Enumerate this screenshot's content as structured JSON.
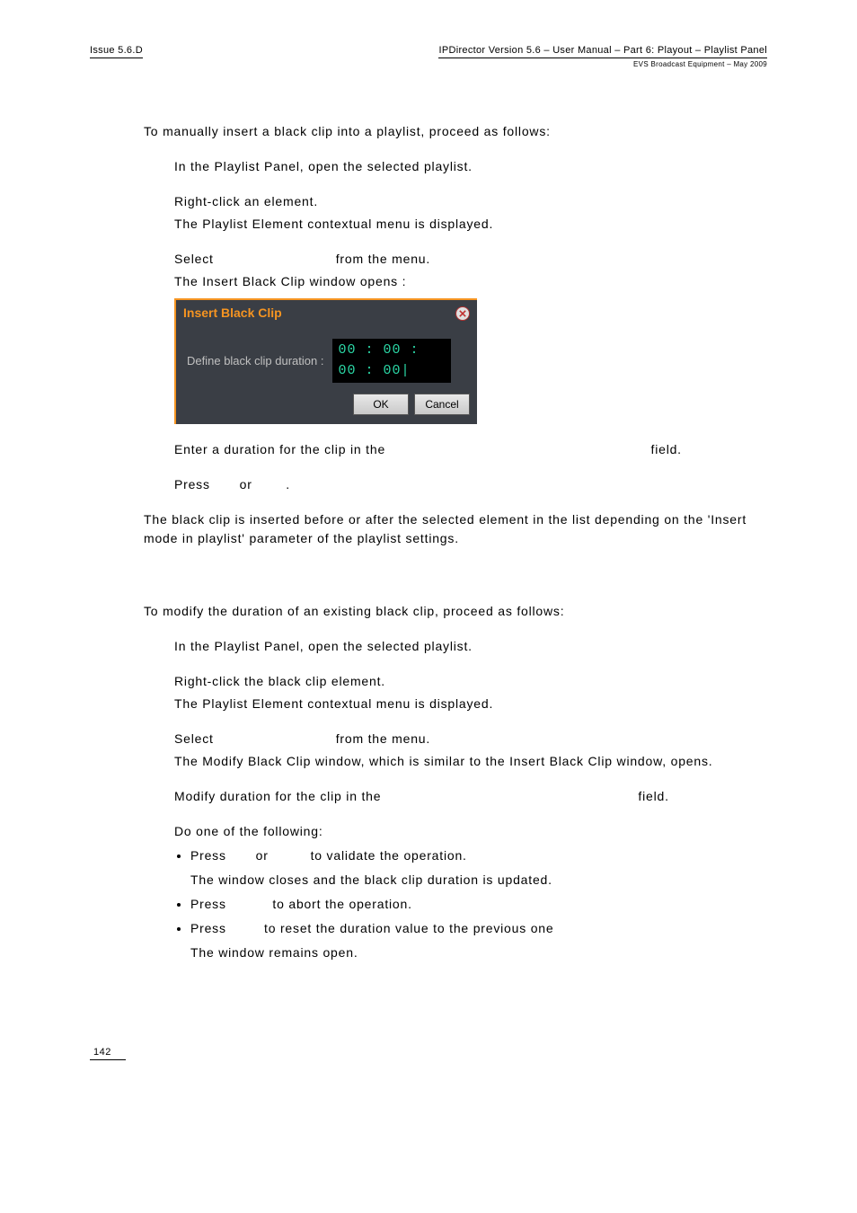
{
  "header": {
    "left": "Issue 5.6.D",
    "right_line1": "IPDirector Version 5.6 – User Manual – Part 6: Playout – Playlist Panel",
    "right_line2": "EVS Broadcast Equipment – May 2009"
  },
  "intro1": "To manually insert a black clip into a playlist, proceed as follows:",
  "steps1": {
    "s1": "In the Playlist Panel, open the selected playlist.",
    "s2a": "Right-click an element.",
    "s2b": "The Playlist Element contextual menu is displayed.",
    "s3a_pre": "Select ",
    "s3a_post": " from the menu.",
    "s3b": "The Insert Black Clip window opens :",
    "s4_pre": "Enter a duration for the clip in the ",
    "s4_post": " field.",
    "s5_pre": "Press ",
    "s5_mid": " or ",
    "s5_post": "."
  },
  "dialog": {
    "title": "Insert Black Clip",
    "label": "Define black clip duration :",
    "value": "00 : 00 : 00 : 00|",
    "ok": "OK",
    "cancel": "Cancel"
  },
  "outro1": "The black clip is inserted before or after the selected element in the list depending on the 'Insert mode in playlist' parameter of the playlist settings.",
  "intro2": "To modify the duration of an existing black clip, proceed as follows:",
  "steps2": {
    "s1": "In the Playlist Panel, open the selected playlist.",
    "s2a": "Right-click the black clip element.",
    "s2b": "The Playlist Element contextual menu is displayed.",
    "s3a_pre": "Select ",
    "s3a_post": " from the menu.",
    "s3b": "The Modify Black Clip window, which is similar to the Insert Black Clip window, opens.",
    "s4_pre": "Modify duration for the clip in the ",
    "s4_post": " field.",
    "s5": "Do one of the following:",
    "b1_pre": "Press ",
    "b1_mid": " or ",
    "b1_post": " to validate the operation.",
    "b1_sub": "The window closes and the black clip duration is updated.",
    "b2_pre": "Press ",
    "b2_post": " to abort the operation.",
    "b3_pre": "Press ",
    "b3_post": " to reset the duration value to the previous one",
    "b3_sub": "The window remains open."
  },
  "page_number": "142"
}
